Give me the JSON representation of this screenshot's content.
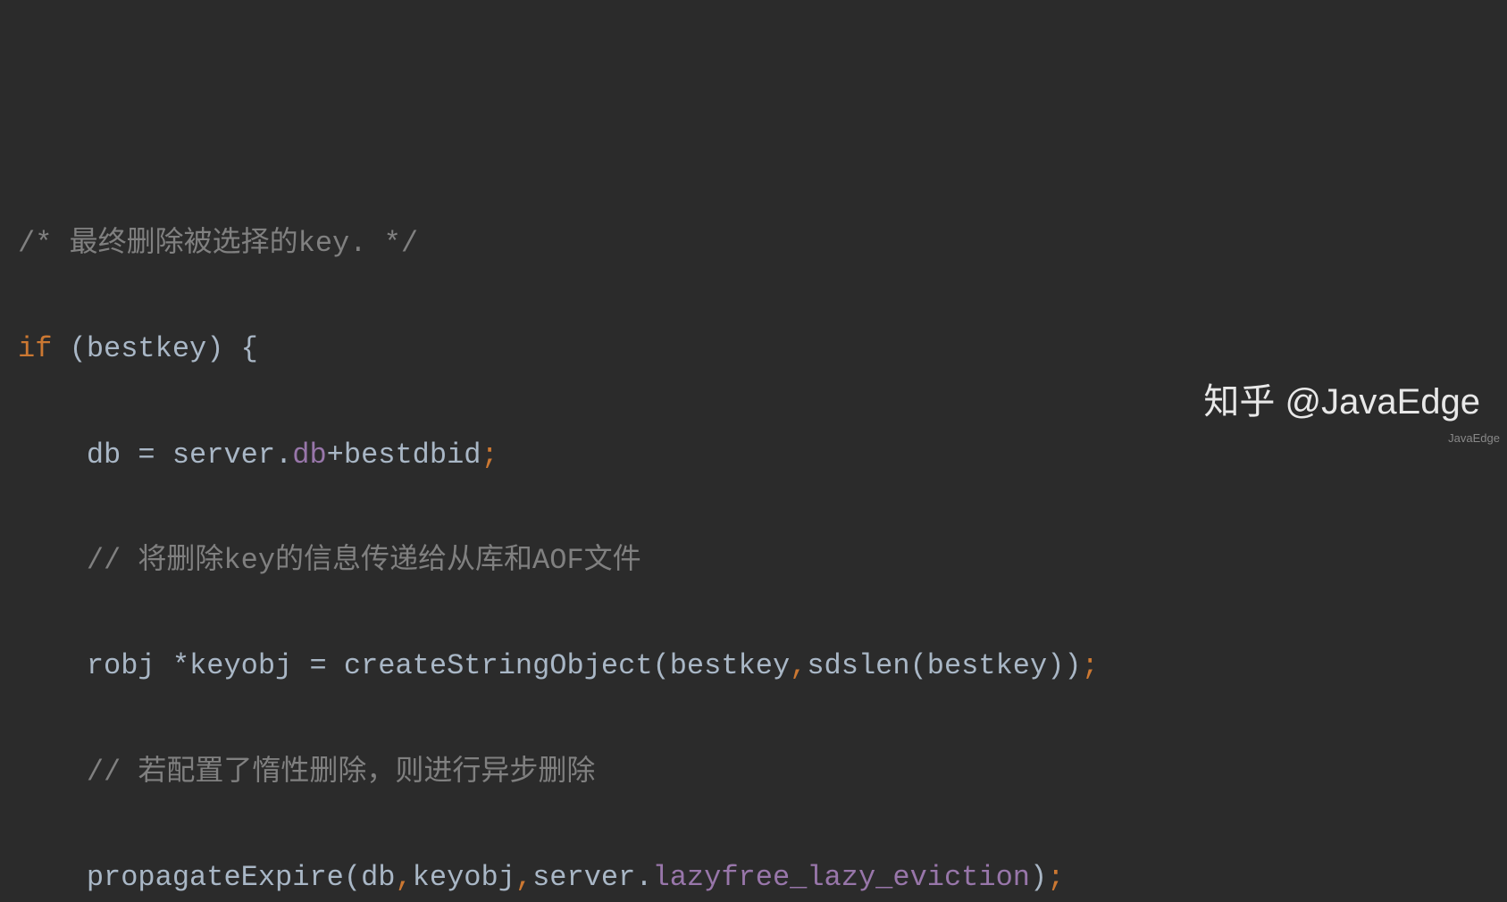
{
  "code": {
    "line1": {
      "comment": "/* 最终删除被选择的key. */"
    },
    "line2": {
      "keyword_if": "if",
      "paren_open": " (",
      "var_bestkey": "bestkey",
      "paren_close": ") ",
      "brace_open": "{"
    },
    "line3": {
      "indent": "    ",
      "var_db": "db",
      "assign": " = ",
      "var_server": "server",
      "dot": ".",
      "field_db": "db",
      "plus": "+",
      "var_bestdbid": "bestdbid",
      "semi": ";"
    },
    "line4": {
      "indent": "    ",
      "comment": "// 将删除key的信息传递给从库和AOF文件"
    },
    "line5": {
      "indent": "    ",
      "type_robj": "robj ",
      "star": "*",
      "var_keyobj": "keyobj",
      "assign": " = ",
      "func_createStringObject": "createStringObject",
      "paren_open": "(",
      "arg_bestkey1": "bestkey",
      "comma1": ",",
      "func_sdslen": "sdslen",
      "paren_open2": "(",
      "arg_bestkey2": "bestkey",
      "paren_close2": ")",
      "paren_close": ")",
      "semi": ";"
    },
    "line6": {
      "indent": "    ",
      "comment": "// 若配置了惰性删除，则进行异步删除"
    },
    "line7": {
      "indent": "    ",
      "func_propagateExpire": "propagateExpire",
      "paren_open": "(",
      "arg_db": "db",
      "comma1": ",",
      "arg_keyobj": "keyobj",
      "comma2": ",",
      "var_server": "server",
      "dot": ".",
      "field_lazyfree": "lazyfree_lazy_eviction",
      "paren_close": ")",
      "semi": ";"
    }
  },
  "watermark": "知乎 @JavaEdge",
  "watermark_small": "JavaEdge"
}
